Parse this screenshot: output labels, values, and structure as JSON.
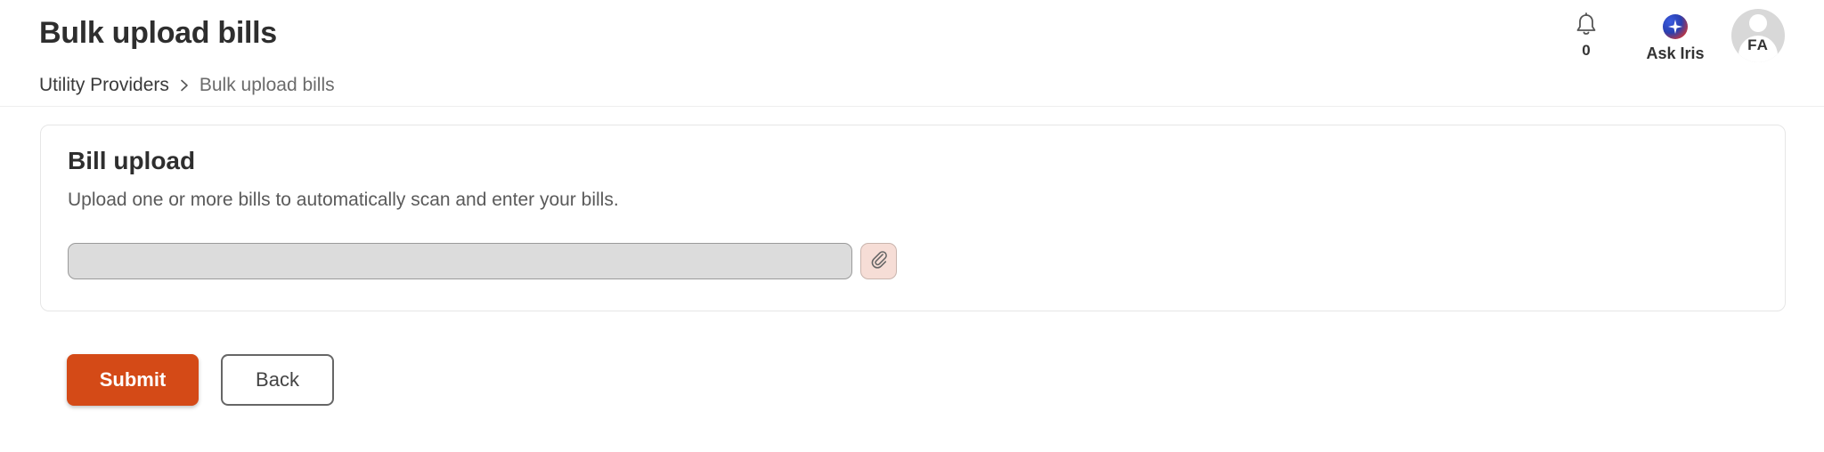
{
  "header": {
    "title": "Bulk upload bills",
    "breadcrumb": {
      "parent": "Utility Providers",
      "current": "Bulk upload bills"
    },
    "notifications": {
      "icon": "bell-icon",
      "count": "0"
    },
    "assistant": {
      "icon": "sparkle-icon",
      "label": "Ask Iris"
    },
    "user": {
      "initials": "FA"
    }
  },
  "card": {
    "title": "Bill upload",
    "description": "Upload one or more bills to automatically scan and enter your bills.",
    "file_input": {
      "value": "",
      "icon": "paperclip-icon"
    }
  },
  "actions": {
    "submit_label": "Submit",
    "back_label": "Back"
  },
  "colors": {
    "primary": "#d44a17",
    "attach_bg": "#f6ddd6",
    "input_bg": "#dcdcdc"
  }
}
